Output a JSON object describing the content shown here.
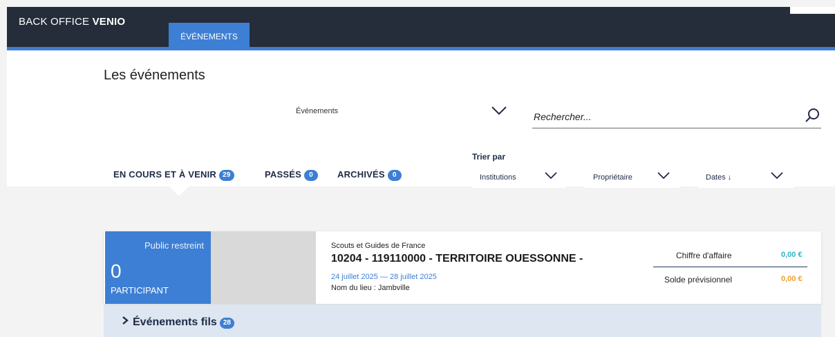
{
  "header": {
    "brand_prefix": "BACK OFFICE",
    "brand_name": "VENIO",
    "nav_tab": "ÉVÉNEMENTS"
  },
  "page": {
    "title": "Les événements"
  },
  "filters": {
    "type_select": "Événements",
    "search_placeholder": "Rechercher..."
  },
  "tabs": [
    {
      "label": "EN COURS ET À VENIR",
      "count": "29"
    },
    {
      "label": "PASSÉS",
      "count": "0"
    },
    {
      "label": "ARCHIVÉS",
      "count": "0"
    }
  ],
  "sort": {
    "label": "Trier par",
    "options": [
      "Institutions",
      "Propriétaire",
      "Dates ↓"
    ]
  },
  "event_card": {
    "status": "Public restreint",
    "participant_count": "0",
    "participant_unit": "PARTICIPANT",
    "organization": "Scouts et Guides de France",
    "title": "10204 - 119110000 - TERRITOIRE OUESSONNE -",
    "dates": "24 juillet 2025 — 28 juillet 2025",
    "place": "Nom du lieu : Jambville",
    "revenue_label": "Chiffre d'affaire",
    "revenue_value": "0,00 €",
    "balance_label": "Solde prévisionnel",
    "balance_value": "0,00 €"
  },
  "child_events": {
    "label": "Événements fils",
    "count": "28"
  },
  "colors": {
    "header_bg": "#252d3a",
    "accent": "#3d7fd4",
    "revenue": "#2db3c4",
    "balance": "#f0a030"
  },
  "icons": [
    "chevron-down-icon",
    "search-icon",
    "chevron-right-icon"
  ]
}
